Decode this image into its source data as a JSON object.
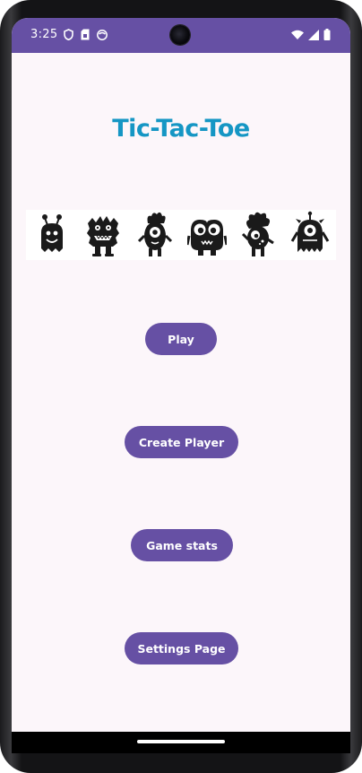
{
  "status_bar": {
    "time": "3:25",
    "left_icons": [
      "shield-icon",
      "sim-card-icon",
      "face-icon"
    ],
    "right_icons": [
      "wifi-icon",
      "cell-signal-icon",
      "battery-icon"
    ],
    "color": "#6650a4"
  },
  "app": {
    "title": "Tic-Tac-Toe",
    "title_color": "#1596c4"
  },
  "monsters": [
    "monster-antenna-icon",
    "monster-furry-icon",
    "monster-cyclops-icon",
    "monster-big-eyes-icon",
    "monster-spiky-icon",
    "monster-yeti-icon"
  ],
  "menu": {
    "play_label": "Play",
    "create_player_label": "Create Player",
    "game_stats_label": "Game stats",
    "settings_label": "Settings Page",
    "button_color": "#6650a4"
  }
}
